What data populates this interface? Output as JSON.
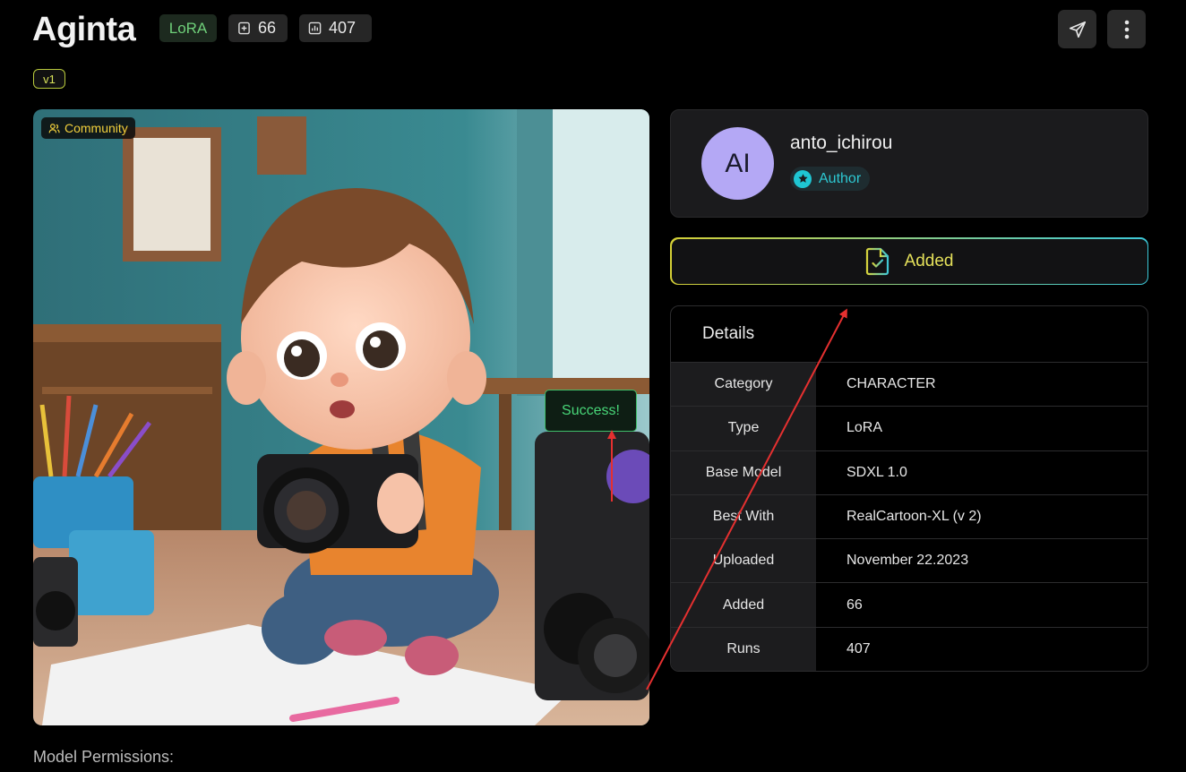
{
  "header": {
    "title": "Aginta",
    "type_chip": "LoRA",
    "adds_count": "66",
    "runs_count": "407",
    "version": "v1"
  },
  "hero": {
    "badge": "Community",
    "toast": "Success!"
  },
  "author": {
    "initials": "AI",
    "name": "anto_ichirou",
    "badge": "Author"
  },
  "action": {
    "label": "Added"
  },
  "details": {
    "heading": "Details",
    "rows": [
      {
        "key": "Category",
        "value": "CHARACTER"
      },
      {
        "key": "Type",
        "value": "LoRA"
      },
      {
        "key": "Base Model",
        "value": "SDXL 1.0"
      },
      {
        "key": "Best With",
        "value": "RealCartoon-XL (v 2)"
      },
      {
        "key": "Uploaded",
        "value": "November 22.2023"
      },
      {
        "key": "Added",
        "value": "66"
      },
      {
        "key": "Runs",
        "value": "407"
      }
    ]
  },
  "footer": {
    "permissions_label": "Model Permissions:"
  },
  "colors": {
    "lora": "#6fd07a",
    "accent_yellow": "#e4e05a",
    "accent_cyan": "#3cc8d8",
    "success": "#48d678",
    "annotation_red": "#e53030"
  }
}
